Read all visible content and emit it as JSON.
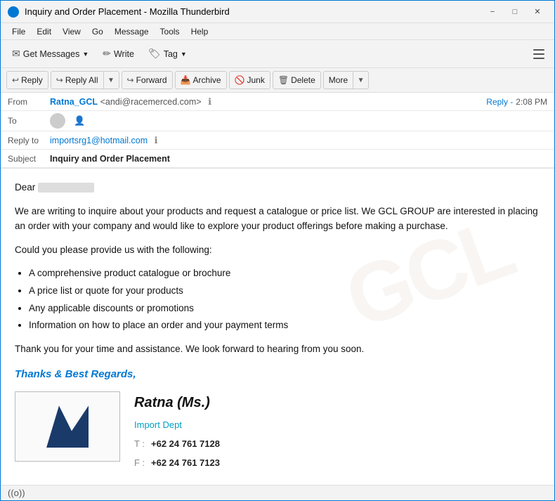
{
  "window": {
    "title": "Inquiry and Order Placement - Mozilla Thunderbird",
    "icon": "thunderbird-icon"
  },
  "menu": {
    "items": [
      "File",
      "Edit",
      "View",
      "Go",
      "Message",
      "Tools",
      "Help"
    ]
  },
  "toolbar": {
    "get_messages": "Get Messages",
    "write": "Write",
    "tag": "Tag"
  },
  "header_toolbar": {
    "reply": "Reply",
    "reply_all": "Reply All",
    "forward": "Forward",
    "archive": "Archive",
    "junk": "Junk",
    "delete": "Delete",
    "more": "More"
  },
  "from": {
    "label": "From",
    "name": "Ratna_GCL",
    "email": "<andi@racemerced.com>"
  },
  "to": {
    "label": "To"
  },
  "reply_to": {
    "label": "Reply to",
    "value": "importsrg1@hotmail.com"
  },
  "subject": {
    "label": "Subject",
    "value": "Inquiry and Order Placement"
  },
  "time": "2:08 PM",
  "reply_indicator": "Reply -",
  "body": {
    "greeting": "Dear",
    "para1": "We are writing to inquire about your products and request a catalogue or price list. We GCL GROUP are interested in placing an order with your company and would like to explore your product offerings before making a purchase.",
    "para2": "Could you please provide us with the following:",
    "list": [
      "A comprehensive product catalogue or brochure",
      "A price list or quote for your products",
      "Any applicable discounts or promotions",
      "Information on how to place an order and your payment terms"
    ],
    "para3": "Thank you for your time and assistance. We look forward to hearing from you soon.",
    "regards": "Thanks & Best Regards,",
    "sig_name": "Ratna (Ms.)",
    "sig_dept": "Import Dept",
    "sig_t_label": "T :",
    "sig_t_value": "+62 24 761 7128",
    "sig_f_label": "F :",
    "sig_f_value": "+62 24 761 7123"
  },
  "status": {
    "wifi": "((o))"
  }
}
